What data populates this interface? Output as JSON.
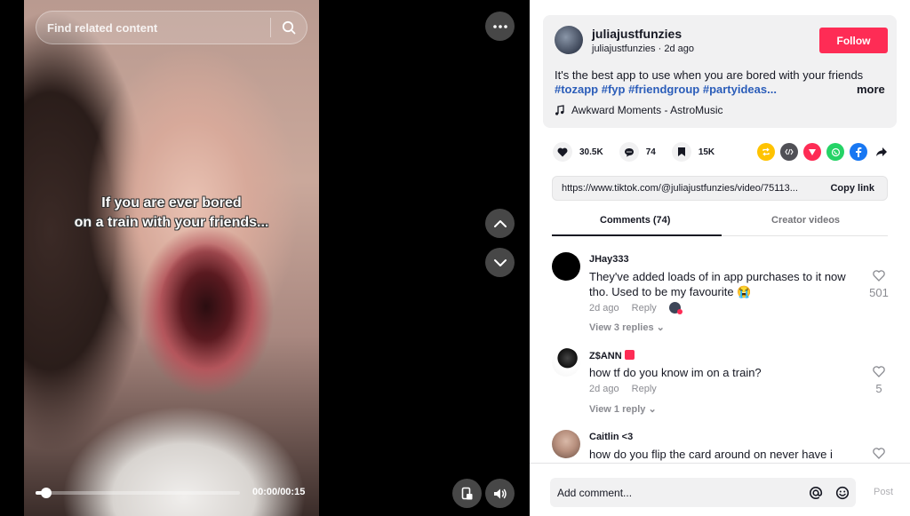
{
  "search": {
    "placeholder": "Find related content"
  },
  "video": {
    "caption_line1": "If you are ever bored",
    "caption_line2": "on a train with your friends...",
    "time": "00:00/00:15",
    "progress": 0.05
  },
  "author": {
    "name": "juliajustfunzies",
    "handle": "juliajustfunzies",
    "age": "2d ago",
    "follow_label": "Follow"
  },
  "post": {
    "description": "It's the best app to use when you are bored with your friends",
    "hashtags": "#tozapp #fyp #friendgroup #partyideas...",
    "more_label": "more",
    "music": "Awkward Moments - AstroMusic"
  },
  "stats": {
    "likes": "30.5K",
    "comments": "74",
    "saves": "15K"
  },
  "share_link": {
    "url": "https://www.tiktok.com/@juliajustfunzies/video/75113...",
    "copy_label": "Copy link"
  },
  "tabs": {
    "comments": "Comments (74)",
    "creator": "Creator videos"
  },
  "comments": [
    {
      "user": "JHay333",
      "text": "They've added loads of in app purchases to it now tho. Used to be my favourite 😭",
      "age": "2d ago",
      "reply": "Reply",
      "replies": "View 3 replies",
      "likes": "501"
    },
    {
      "user": "Z$ANN",
      "text": "how tf do you know im on a train?",
      "age": "2d ago",
      "reply": "Reply",
      "replies": "View 1 reply",
      "likes": "5"
    },
    {
      "user": "Caitlin <3",
      "text": "how do you flip the card around on never have i",
      "age": "",
      "reply": "",
      "replies": "",
      "likes": ""
    }
  ],
  "footer": {
    "placeholder": "Add comment...",
    "post_label": "Post"
  },
  "colors": {
    "accent": "#fe2c55",
    "hashtag": "#2b5db9"
  }
}
